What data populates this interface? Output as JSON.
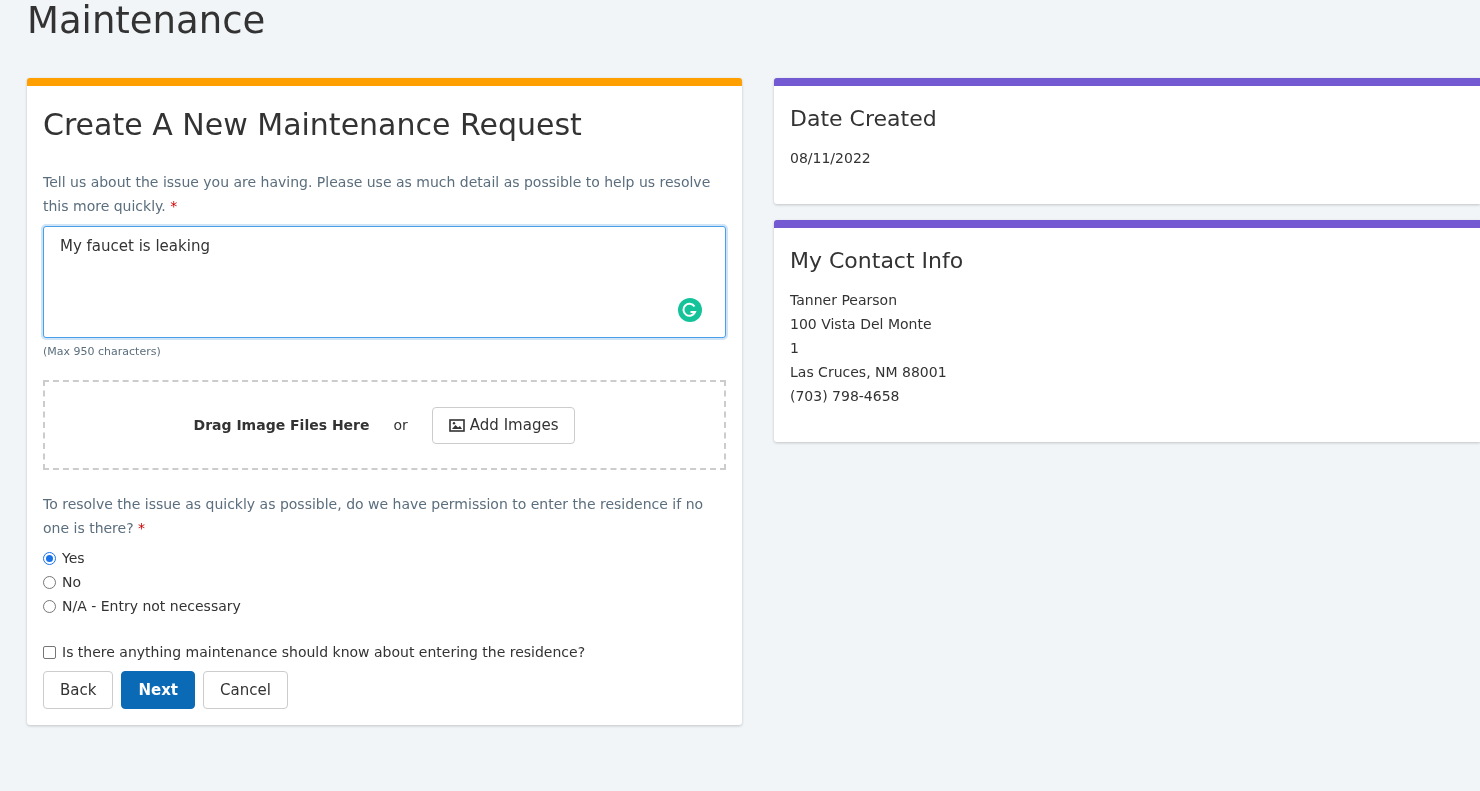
{
  "page_title": "Maintenance",
  "request_card": {
    "title": "Create A New Maintenance Request",
    "description": {
      "label": "Tell us about the issue you are having. Please use as much detail as possible to help us resolve this more quickly.",
      "required_mark": "*",
      "value": "My faucet is leaking",
      "focused": true,
      "hint": "(Max 950 characters)"
    },
    "upload": {
      "drop_text": "Drag Image Files Here",
      "or_text": "or",
      "button": "Add Images"
    },
    "permission": {
      "label": "To resolve the issue as quickly as possible, do we have permission to enter the residence if no one is there?",
      "required_mark": "*",
      "options": [
        {
          "label": "Yes",
          "selected": true
        },
        {
          "label": "No",
          "selected": false
        },
        {
          "label": "N/A - Entry not necessary",
          "selected": false
        }
      ]
    },
    "entry_notes": {
      "label": "Is there anything maintenance should know about entering the residence?",
      "checked": false
    },
    "buttons": [
      {
        "label": "Back",
        "primary": false
      },
      {
        "label": "Next",
        "primary": true
      },
      {
        "label": "Cancel",
        "primary": false
      }
    ]
  },
  "side_cards": [
    {
      "title": "Date Created",
      "lines": [
        "08/11/2022"
      ]
    },
    {
      "title": "My Contact Info",
      "lines": [
        "Tanner Pearson",
        "100 Vista Del Monte",
        "1",
        "Las Cruces, NM 88001",
        "(703) 798-4658"
      ]
    }
  ]
}
